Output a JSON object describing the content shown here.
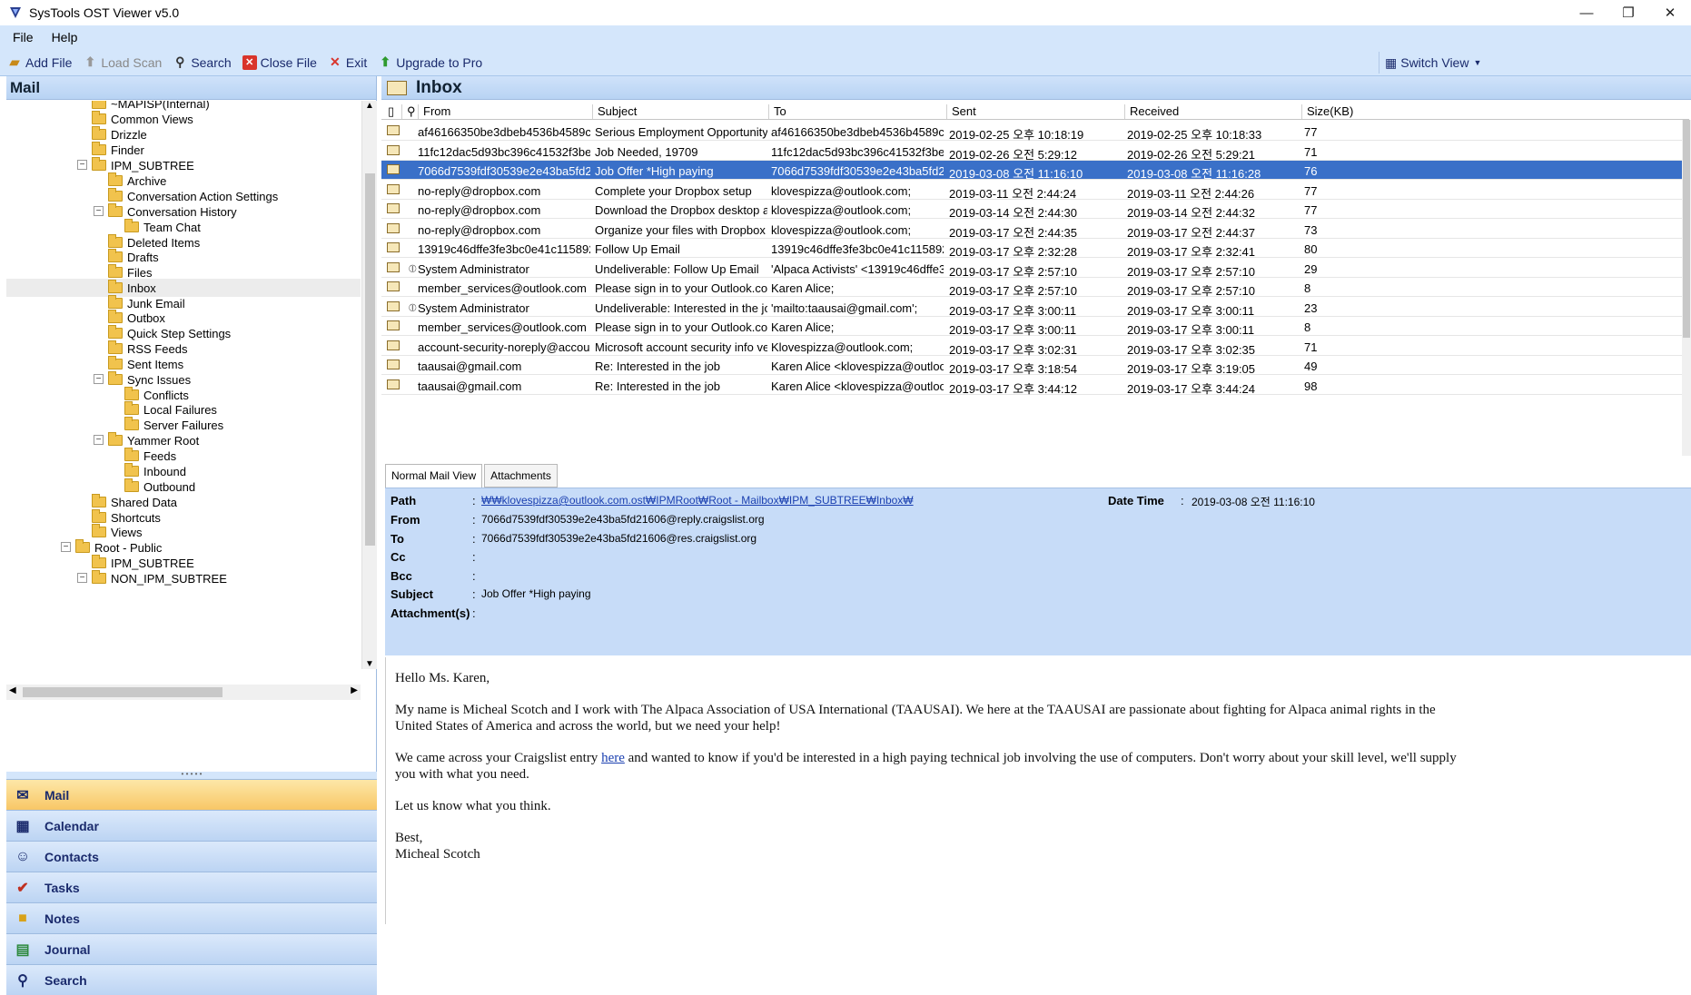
{
  "window": {
    "title": "SysTools OST Viewer v5.0",
    "min": "—",
    "restore": "❐",
    "close": "✕"
  },
  "menu": [
    "File",
    "Help"
  ],
  "toolbar": {
    "add_file": "Add File",
    "load_scan": "Load Scan",
    "search": "Search",
    "close_file": "Close File",
    "exit": "Exit",
    "upgrade": "Upgrade to Pro",
    "switch_view": "Switch View"
  },
  "left": {
    "header": "Mail",
    "tree": [
      {
        "label": "~MAPISP(Internal)"
      },
      {
        "label": "Common Views"
      },
      {
        "label": "Drizzle"
      },
      {
        "label": "Finder"
      },
      {
        "label": "IPM_SUBTREE"
      },
      {
        "label": "Archive"
      },
      {
        "label": "Conversation Action Settings"
      },
      {
        "label": "Conversation History"
      },
      {
        "label": "Team Chat"
      },
      {
        "label": "Deleted Items"
      },
      {
        "label": "Drafts"
      },
      {
        "label": "Files"
      },
      {
        "label": "Inbox"
      },
      {
        "label": "Junk Email"
      },
      {
        "label": "Outbox"
      },
      {
        "label": "Quick Step Settings"
      },
      {
        "label": "RSS Feeds"
      },
      {
        "label": "Sent Items"
      },
      {
        "label": "Sync Issues"
      },
      {
        "label": "Conflicts"
      },
      {
        "label": "Local Failures"
      },
      {
        "label": "Server Failures"
      },
      {
        "label": "Yammer Root"
      },
      {
        "label": "Feeds"
      },
      {
        "label": "Inbound"
      },
      {
        "label": "Outbound"
      },
      {
        "label": "Shared Data"
      },
      {
        "label": "Shortcuts"
      },
      {
        "label": "Views"
      },
      {
        "label": "Root - Public"
      },
      {
        "label": "IPM_SUBTREE"
      },
      {
        "label": "NON_IPM_SUBTREE"
      }
    ],
    "nav": [
      "Mail",
      "Calendar",
      "Contacts",
      "Tasks",
      "Notes",
      "Journal",
      "Search"
    ]
  },
  "inbox": {
    "header": "Inbox",
    "columns": [
      "From",
      "Subject",
      "To",
      "Sent",
      "Received",
      "Size(KB)"
    ],
    "rows": [
      {
        "from": "af46166350be3dbeb4536b4589c5ca3...",
        "subject": "Serious Employment Opportunity Fro...",
        "to": "af46166350be3dbeb4536b4589c5ca32...",
        "sent": "2019-02-25 오후 10:18:19",
        "received": "2019-02-25 오후 10:18:33",
        "size": "77"
      },
      {
        "from": "11fc12dac5d93bc396c41532f3be1ab7...",
        "subject": "Job Needed, 19709",
        "to": "11fc12dac5d93bc396c41532f3be1ab7...",
        "sent": "2019-02-26 오전 5:29:12",
        "received": "2019-02-26 오전 5:29:21",
        "size": "71"
      },
      {
        "from": "7066d7539fdf30539e2e43ba5fd21606...",
        "subject": "Job Offer *High paying",
        "to": "7066d7539fdf30539e2e43ba5fd21606...",
        "sent": "2019-03-08 오전 11:16:10",
        "received": "2019-03-08 오전 11:16:28",
        "size": "76"
      },
      {
        "from": "no-reply@dropbox.com",
        "subject": "Complete your Dropbox setup",
        "to": "klovespizza@outlook.com;",
        "sent": "2019-03-11 오전 2:44:24",
        "received": "2019-03-11 오전 2:44:26",
        "size": "77"
      },
      {
        "from": "no-reply@dropbox.com",
        "subject": "Download the Dropbox desktop app",
        "to": "klovespizza@outlook.com;",
        "sent": "2019-03-14 오전 2:44:30",
        "received": "2019-03-14 오전 2:44:32",
        "size": "77"
      },
      {
        "from": "no-reply@dropbox.com",
        "subject": "Organize your files with Dropbox fol...",
        "to": "klovespizza@outlook.com;",
        "sent": "2019-03-17 오전 2:44:35",
        "received": "2019-03-17 오전 2:44:37",
        "size": "73"
      },
      {
        "from": "13919c46dffe3fe3bc0e41c115892ba7...",
        "subject": "Follow Up Email",
        "to": "13919c46dffe3fe3bc0e41c115892ba7...",
        "sent": "2019-03-17 오후 2:32:28",
        "received": "2019-03-17 오후 2:32:41",
        "size": "80"
      },
      {
        "from": "System Administrator",
        "subject": "Undeliverable: Follow Up Email",
        "to": "'Alpaca Activists' <13919c46dffe3fe3b...",
        "sent": "2019-03-17 오후 2:57:10",
        "received": "2019-03-17 오후 2:57:10",
        "size": "29"
      },
      {
        "from": "member_services@outlook.com",
        "subject": "Please sign in to your Outlook.com a...",
        "to": "Karen Alice;",
        "sent": "2019-03-17 오후 2:57:10",
        "received": "2019-03-17 오후 2:57:10",
        "size": "8"
      },
      {
        "from": "System Administrator",
        "subject": "Undeliverable: Interested in the job",
        "to": "'mailto:taausai@gmail.com';",
        "sent": "2019-03-17 오후 3:00:11",
        "received": "2019-03-17 오후 3:00:11",
        "size": "23"
      },
      {
        "from": "member_services@outlook.com",
        "subject": "Please sign in to your Outlook.com a...",
        "to": "Karen Alice;",
        "sent": "2019-03-17 오후 3:00:11",
        "received": "2019-03-17 오후 3:00:11",
        "size": "8"
      },
      {
        "from": "account-security-noreply@accountpr...",
        "subject": "Microsoft account security info verifi...",
        "to": "Klovespizza@outlook.com;",
        "sent": "2019-03-17 오후 3:02:31",
        "received": "2019-03-17 오후 3:02:35",
        "size": "71"
      },
      {
        "from": "taausai@gmail.com",
        "subject": "Re: Interested in the job",
        "to": "Karen Alice <klovespizza@outlook.co...",
        "sent": "2019-03-17 오후 3:18:54",
        "received": "2019-03-17 오후 3:19:05",
        "size": "49"
      },
      {
        "from": "taausai@gmail.com",
        "subject": "Re: Interested in the job",
        "to": "Karen Alice <klovespizza@outlook.co...",
        "sent": "2019-03-17 오후 3:44:12",
        "received": "2019-03-17 오후 3:44:24",
        "size": "98"
      }
    ]
  },
  "preview": {
    "tabs": [
      "Normal Mail View",
      "Attachments"
    ],
    "labels": {
      "path": "Path",
      "from": "From",
      "to": "To",
      "cc": "Cc",
      "bcc": "Bcc",
      "subject": "Subject",
      "attachments": "Attachment(s)",
      "datetime": "Date Time"
    },
    "path_link": "₩₩klovespizza@outlook.com.ost₩IPMRoot₩Root",
    "path_rest": " - Mailbox₩IPM_SUBTREE₩Inbox₩",
    "datetime": "2019-03-08 오전 11:16:10",
    "from": "7066d7539fdf30539e2e43ba5fd21606@reply.craigslist.org",
    "to": "7066d7539fdf30539e2e43ba5fd21606@res.craigslist.org",
    "cc": "",
    "bcc": "",
    "subject": "Job Offer *High paying",
    "attachments": "",
    "body": {
      "greeting": "Hello Ms. Karen,",
      "p1": "My name is Micheal Scotch and I work with The Alpaca Association of USA International (TAAUSAI). We here at the TAAUSAI are passionate about fighting for Alpaca animal rights in the United States of America and across the world, but we need your help!",
      "p2_before": "We came across your Craigslist entry ",
      "p2_link": "here",
      "p2_after": " and wanted to know if you'd be interested in a high paying technical job involving the use of computers. Don't worry about your skill level, we'll supply you with what you need.",
      "p3": "Let us know what you think.",
      "closing": "Best,",
      "signature": "Micheal Scotch"
    }
  },
  "colors": {
    "ribbon": "#d4e6fb",
    "selection": "#3a70c8",
    "details": "#c7dcf8",
    "active_nav": "#f8c766"
  }
}
